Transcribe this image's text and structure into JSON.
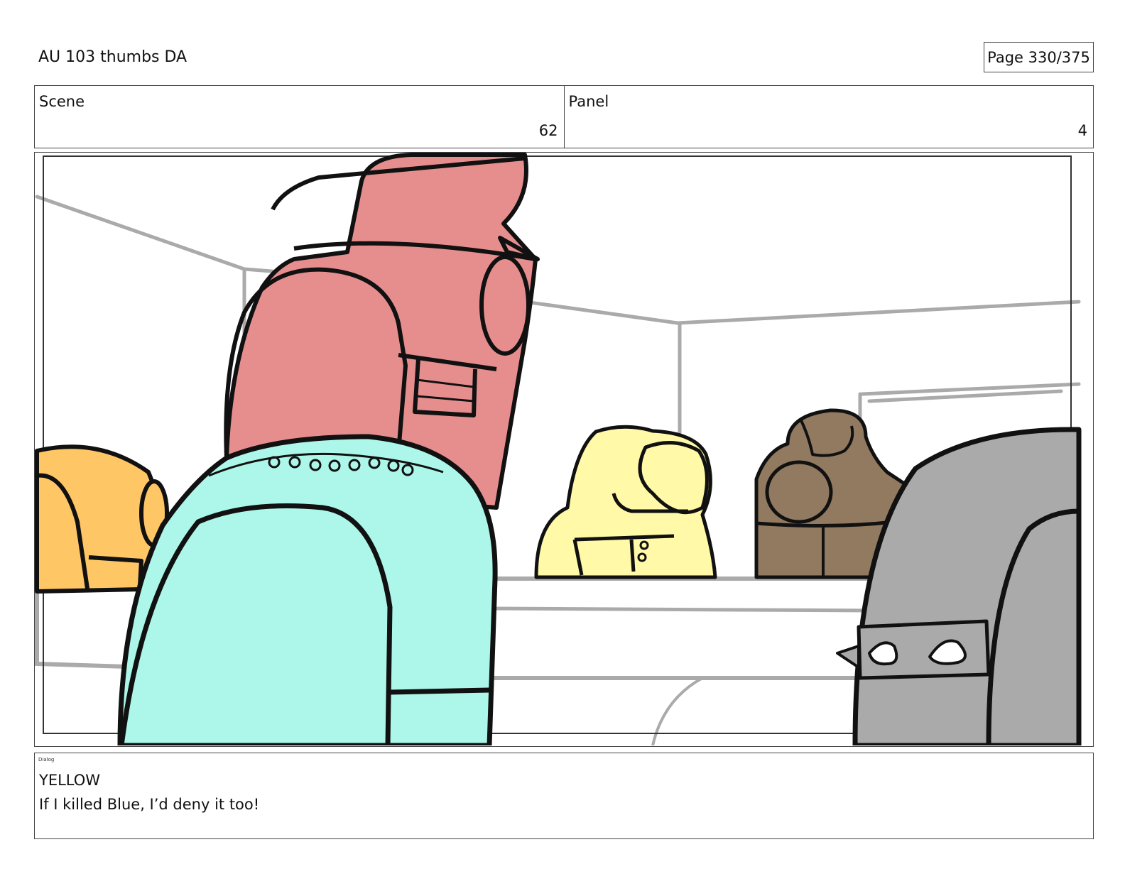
{
  "header": {
    "title": "AU 103 thumbs DA",
    "page": "Page 330/375"
  },
  "info": {
    "scene_label": "Scene",
    "scene_value": "62",
    "panel_label": "Panel",
    "panel_value": "4"
  },
  "dialog": {
    "heading": "Dialog",
    "speaker": "YELLOW",
    "line": "If I killed Blue, I’d deny it too!"
  },
  "colors": {
    "pink": "#e68e8e",
    "cyan": "#adf7ea",
    "yellow": "#fff9a8",
    "orange": "#ffc666",
    "brown": "#917a60",
    "gray": "#aaaaaa"
  }
}
